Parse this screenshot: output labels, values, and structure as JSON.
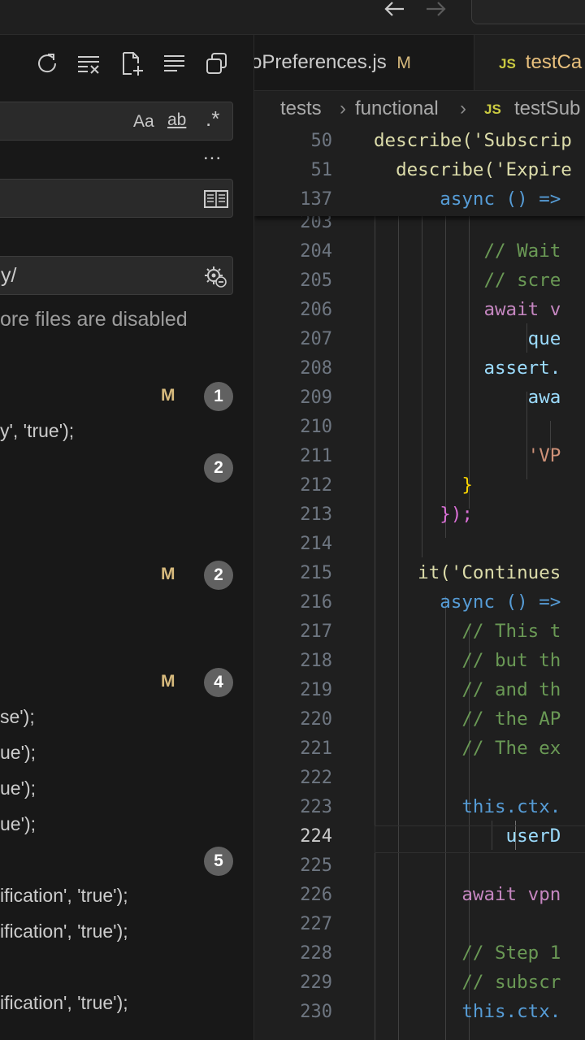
{
  "title_bar": {
    "back_icon": "arrow-left-icon",
    "forward_icon": "arrow-right-icon"
  },
  "sidebar": {
    "toolbar_icons": [
      "refresh-icon",
      "clear-results-icon",
      "new-search-editor-icon",
      "collapse-all-icon",
      "view-as-tree-icon"
    ],
    "search_options": {
      "match_case": "Aa",
      "whole_word": "ab",
      "regex": ".*"
    },
    "more": "...",
    "include_value": "y/",
    "exclude_notice": "ore files are disabled",
    "files": [
      {
        "status": "M",
        "count": "1"
      },
      {
        "status": "",
        "count": "2"
      },
      {
        "status": "M",
        "count": "2"
      },
      {
        "status": "M",
        "count": "4"
      },
      {
        "status": "",
        "count": "5"
      }
    ],
    "results": [
      "y', 'true');",
      "se');",
      "ue');",
      "ue');",
      "ue');",
      "ification', 'true');",
      "ification', 'true');",
      "ification', 'true');"
    ]
  },
  "tabs": [
    {
      "label": "oPreferences.js",
      "status": "M",
      "active": false
    },
    {
      "label": "testCa",
      "icon": "JS",
      "active": true
    }
  ],
  "breadcrumb": [
    "tests",
    "functional",
    "testSub"
  ],
  "breadcrumb_icon": "JS",
  "sticky_lines": [
    {
      "num": "50",
      "text": "describe('Subscrip"
    },
    {
      "num": "51",
      "text": "  describe('Expire"
    },
    {
      "num": "137",
      "text": "      async () =>"
    }
  ],
  "code_lines": [
    {
      "num": "203",
      "text": ""
    },
    {
      "num": "204",
      "text": "          // Wait"
    },
    {
      "num": "205",
      "text": "          // scre"
    },
    {
      "num": "206",
      "text": "          await v"
    },
    {
      "num": "207",
      "text": "              que"
    },
    {
      "num": "208",
      "text": "          assert."
    },
    {
      "num": "209",
      "text": "              awa"
    },
    {
      "num": "210",
      "text": ""
    },
    {
      "num": "211",
      "text": "              'VP"
    },
    {
      "num": "212",
      "text": "        }"
    },
    {
      "num": "213",
      "text": "      });"
    },
    {
      "num": "214",
      "text": ""
    },
    {
      "num": "215",
      "text": "    it('Continues"
    },
    {
      "num": "216",
      "text": "      async () =>"
    },
    {
      "num": "217",
      "text": "        // This t"
    },
    {
      "num": "218",
      "text": "        // but th"
    },
    {
      "num": "219",
      "text": "        // and th"
    },
    {
      "num": "220",
      "text": "        // the AP"
    },
    {
      "num": "221",
      "text": "        // The ex"
    },
    {
      "num": "222",
      "text": ""
    },
    {
      "num": "223",
      "text": "        this.ctx."
    },
    {
      "num": "224",
      "text": "            userD"
    },
    {
      "num": "225",
      "text": ""
    },
    {
      "num": "226",
      "text": "        await vpn"
    },
    {
      "num": "227",
      "text": ""
    },
    {
      "num": "228",
      "text": "        // Step 1"
    },
    {
      "num": "229",
      "text": "        // subscr"
    },
    {
      "num": "230",
      "text": "        this.ctx."
    }
  ],
  "current_line": "224"
}
